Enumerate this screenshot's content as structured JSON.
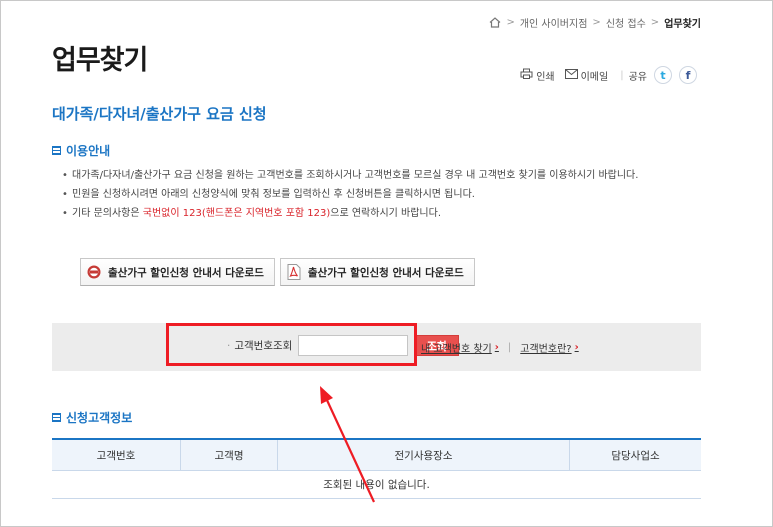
{
  "breadcrumb": {
    "items": [
      "개인 사이버지점",
      "신청 접수"
    ],
    "current": "업무찾기"
  },
  "page": {
    "title": "업무찾기"
  },
  "tools": {
    "print": "인쇄",
    "email": "이메일",
    "share": "공유",
    "twitter_glyph": "t",
    "facebook_glyph": "f"
  },
  "section": {
    "title": "대가족/다자녀/출산가구 요금 신청"
  },
  "info": {
    "title": "이용안내",
    "lines": [
      "대가족/다자녀/출산가구 요금 신청을 원하는 고객번호를 조회하시거나 고객번호를 모르실 경우 내 고객번호 찾기를 이용하시기 바랍니다.",
      "민원을 신청하시려면 아래의 신청양식에 맞춰 정보를 입력하신 후 신청버튼을 클릭하시면 됩니다."
    ],
    "contact_prefix": "기타 문의사항은 ",
    "contact_red": "국번없이 123(핸드폰은 지역번호 포함 123)",
    "contact_suffix": "으로 연락하시기 바랍니다."
  },
  "downloads": {
    "hwp_label": "출산가구 할인신청 안내서 다운로드",
    "pdf_label": "출산가구 할인신청 안내서 다운로드"
  },
  "search": {
    "label": "고객번호조회",
    "input_value": "",
    "button_label": "조회",
    "find_link": "내 고객번호 찾기",
    "what_link": "고객번호란?"
  },
  "customer": {
    "title": "신청고객정보",
    "columns": [
      "고객번호",
      "고객명",
      "전기사용장소",
      "담당사업소"
    ],
    "empty_message": "조회된 내용이 없습니다."
  },
  "colors": {
    "accent": "#1b75c4",
    "alert_red": "#d9232a",
    "highlight_red": "#ee1c24",
    "search_button": "#e8504e"
  }
}
